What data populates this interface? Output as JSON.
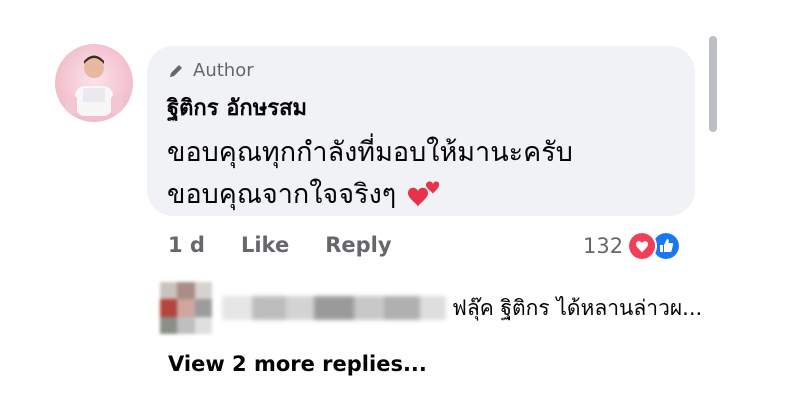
{
  "comment": {
    "badge_label": "Author",
    "author_name": "ฐิติกร อักษรสม",
    "text_line_1": "ขอบคุณทุกกำลังที่มอบให้มานะครับ",
    "text_line_2": "ขอบคุณจากใจจริงๆ",
    "emoji_icon": "two-hearts-icon",
    "time": "1 d",
    "like_label": "Like",
    "reply_label": "Reply",
    "reaction_count": "132",
    "reaction_icons": [
      "love-reaction-icon",
      "like-reaction-icon"
    ]
  },
  "reply_preview": {
    "text": "ฟลุ๊ค ฐิติกร ได้หลานล่าวผ..."
  },
  "view_more_label": "View 2 more replies...",
  "colors": {
    "bubble": "#f0f2f5",
    "secondary_text": "#65676b",
    "like_blue": "#1877f2",
    "love_red": "#f33e58"
  }
}
